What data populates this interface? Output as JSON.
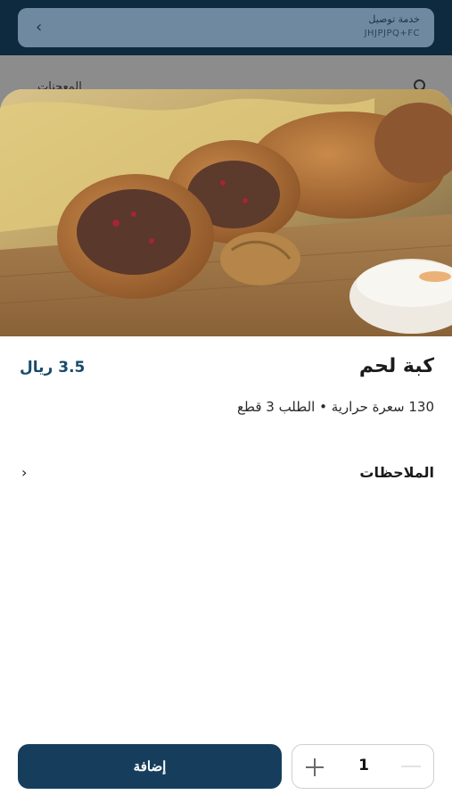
{
  "background": {
    "delivery": {
      "title": "خدمة توصيل",
      "code": "JHJPJPQ+FC"
    },
    "category_label": "المعجنات"
  },
  "item": {
    "name": "كبة لحم",
    "price": "3.5 ريال",
    "meta": "130 سعرة حرارية • الطلب 3 قطع"
  },
  "notes": {
    "label": "الملاحظات"
  },
  "actions": {
    "add_label": "إضافة",
    "quantity": "1"
  },
  "icons": {
    "back": "chevron-left-icon",
    "search": "search-icon",
    "notes": "chevron-right-icon",
    "plus": "plus-icon",
    "minus": "minus-icon"
  },
  "colors": {
    "header": "#0d2a3f",
    "primary": "#163e5c",
    "price": "#184a6b"
  }
}
